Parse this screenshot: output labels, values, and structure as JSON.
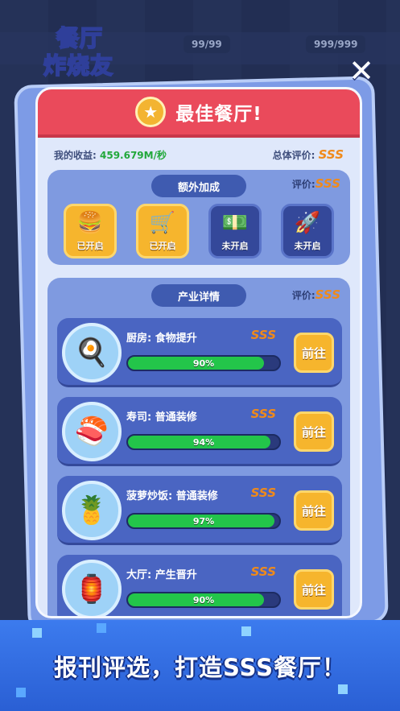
{
  "logo": {
    "line1": "餐厅",
    "line2": "炸烧友"
  },
  "background": {
    "badge1": "99/99",
    "badge2": "999/999"
  },
  "close_label": "✕",
  "header": {
    "title": "最佳餐厅!"
  },
  "income": {
    "label": "我的收益:",
    "value": "459.679M/秒",
    "overall_label": "总体评价:",
    "overall_value": "SSS"
  },
  "bonus": {
    "title": "额外加成",
    "rating_label": "评价:",
    "rating_value": "SSS",
    "items": [
      {
        "icon": "burger-icon",
        "glyph": "🍔",
        "status": "已开启",
        "enabled": true
      },
      {
        "icon": "shopping-cart-icon",
        "glyph": "🛒",
        "status": "已开启",
        "enabled": true
      },
      {
        "icon": "cash-boost-icon",
        "glyph": "💵",
        "status": "未开启",
        "enabled": false
      },
      {
        "icon": "rocket-icon",
        "glyph": "🚀",
        "status": "未开启",
        "enabled": false
      }
    ]
  },
  "industry": {
    "title": "产业详情",
    "rating_label": "评价:",
    "rating_value": "SSS",
    "rows": [
      {
        "icon": "kitchen-icon",
        "glyph": "🍳",
        "name": "厨房: 食物提升",
        "grade": "SSS",
        "progress": 90,
        "progress_text": "90%",
        "button": "前往"
      },
      {
        "icon": "sushi-icon",
        "glyph": "🍣",
        "name": "寿司: 普通装修",
        "grade": "SSS",
        "progress": 94,
        "progress_text": "94%",
        "button": "前往"
      },
      {
        "icon": "pineapple-rice-icon",
        "glyph": "🍍",
        "name": "菠萝炒饭: 普通装修",
        "grade": "SSS",
        "progress": 97,
        "progress_text": "97%",
        "button": "前往"
      },
      {
        "icon": "hall-icon",
        "glyph": "🏮",
        "name": "大厅: 产生晋升",
        "grade": "SSS",
        "progress": 90,
        "progress_text": "90%",
        "button": "前往"
      }
    ]
  },
  "banner": {
    "text": "报刊评选，打造SSS餐厅！"
  }
}
